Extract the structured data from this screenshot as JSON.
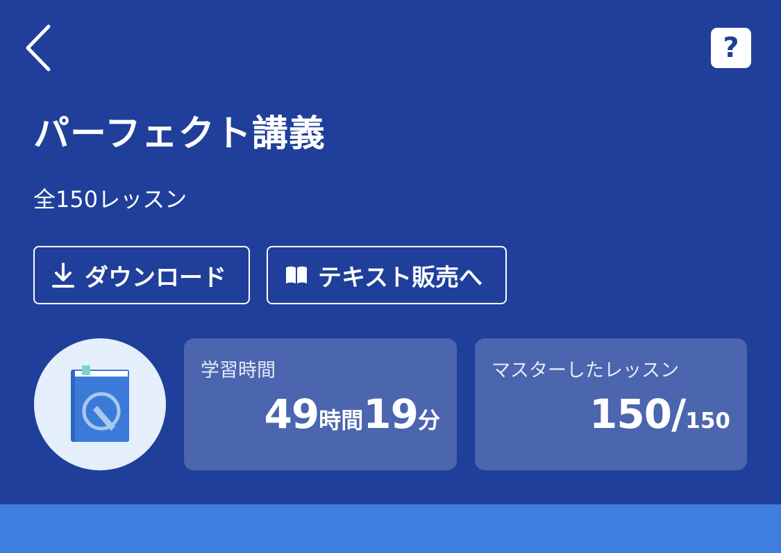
{
  "nav": {
    "back_icon": "chevron-left-icon",
    "help_label": "?"
  },
  "course": {
    "title": "パーフェクト講義",
    "lesson_count_text": "全150レッスン"
  },
  "actions": {
    "download_label": "ダウンロード",
    "download_icon": "download-icon",
    "text_shop_label": "テキスト販売へ",
    "text_shop_icon": "open-book-icon"
  },
  "stats": {
    "study_time": {
      "label": "学習時間",
      "hours": "49",
      "hours_unit": "時間",
      "minutes": "19",
      "minutes_unit": "分"
    },
    "mastered": {
      "label": "マスターしたレッスン",
      "count": "150",
      "separator": "/",
      "total": "150"
    }
  },
  "colors": {
    "header_bg": "#1f3f9a",
    "bottom_bar": "#3d7edf",
    "avatar_bg": "#e4effb",
    "book_blue": "#3b7ad8"
  }
}
